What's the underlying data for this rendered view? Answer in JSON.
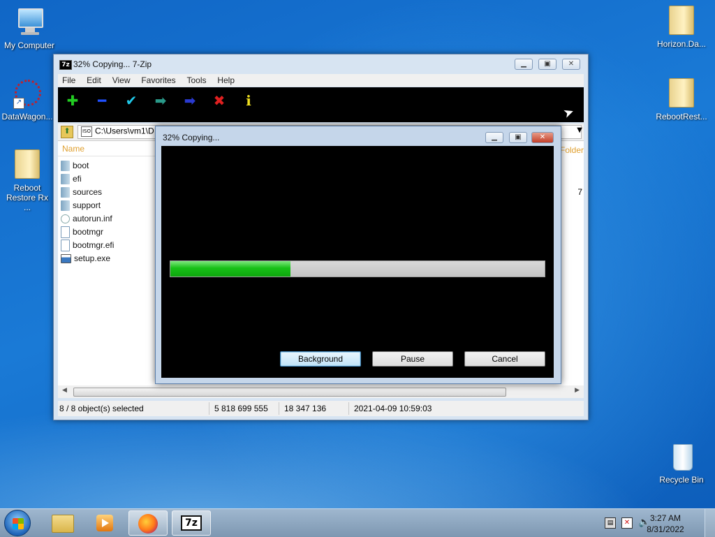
{
  "desktop": {
    "icons_left": [
      {
        "label": "My Computer"
      },
      {
        "label": "DataWagon..."
      },
      {
        "label": "Reboot Restore Rx ..."
      }
    ],
    "icons_right": [
      {
        "label": "Horizon.Da..."
      },
      {
        "label": "RebootRest..."
      },
      {
        "label": "Recycle Bin"
      }
    ]
  },
  "main_window": {
    "app_icon_text": "7z",
    "title": "32% Copying... 7-Zip",
    "menu": [
      "File",
      "Edit",
      "View",
      "Favorites",
      "Tools",
      "Help"
    ],
    "toolbar_icons": [
      "add-icon",
      "extract-icon",
      "test-icon",
      "copy-icon",
      "move-icon",
      "delete-icon",
      "info-icon"
    ],
    "address": "C:\\Users\\vm1\\D",
    "columns": {
      "name": "Name",
      "folders": "Folder"
    },
    "files": [
      {
        "name": "boot",
        "type": "folder"
      },
      {
        "name": "efi",
        "type": "folder"
      },
      {
        "name": "sources",
        "type": "folder"
      },
      {
        "name": "support",
        "type": "folder"
      },
      {
        "name": "autorun.inf",
        "type": "settings-file"
      },
      {
        "name": "bootmgr",
        "type": "file"
      },
      {
        "name": "bootmgr.efi",
        "type": "file"
      },
      {
        "name": "setup.exe",
        "type": "exe"
      }
    ],
    "right_value": "7",
    "status": {
      "selected": "8 / 8 object(s) selected",
      "size": "5 818 699 555",
      "packed": "18 347 136",
      "modified": "2021-04-09 10:59:03"
    }
  },
  "progress_dialog": {
    "title": "32% Copying...",
    "progress": 0.32,
    "buttons": {
      "background": "Background",
      "pause": "Pause",
      "cancel": "Cancel"
    }
  },
  "taskbar": {
    "clock_time": "3:27 AM",
    "clock_date": "8/31/2022",
    "sevenzip_label": "7z"
  }
}
